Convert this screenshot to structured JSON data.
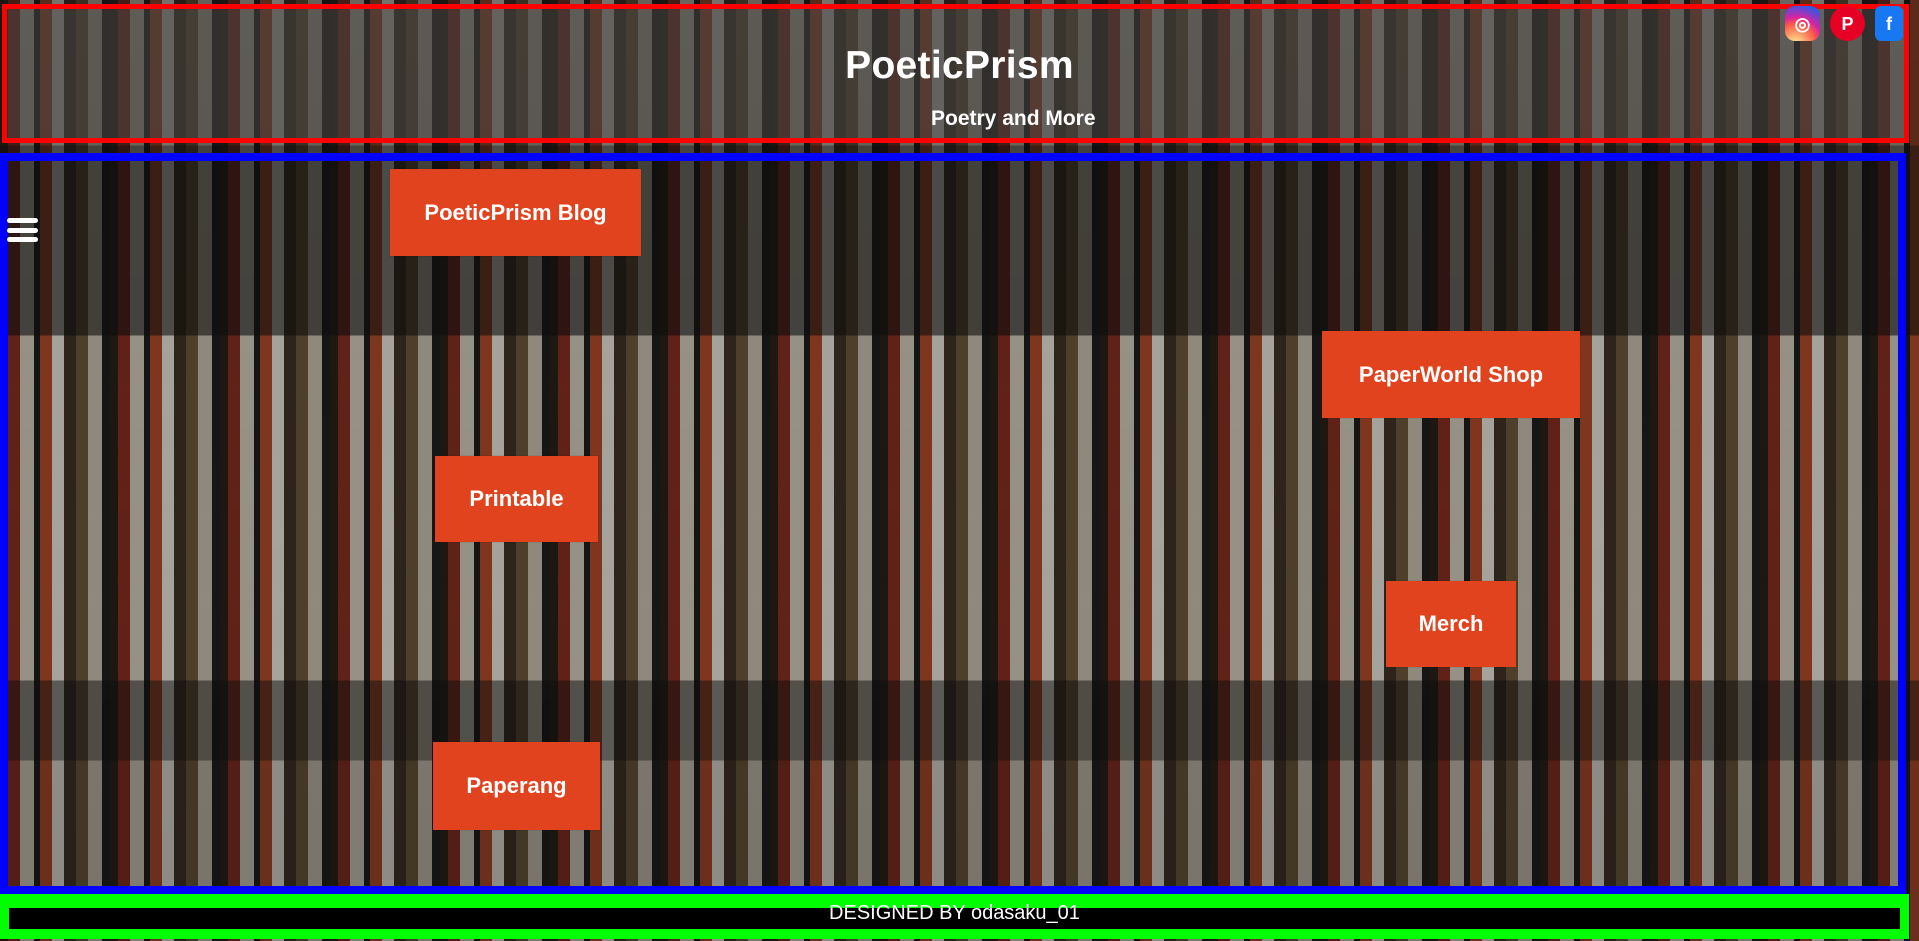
{
  "header": {
    "title": "PoeticPrism",
    "subtitle": "Poetry and More",
    "social": [
      {
        "name": "instagram-icon",
        "glyph": "◎"
      },
      {
        "name": "pinterest-icon",
        "glyph": "P"
      },
      {
        "name": "facebook-icon",
        "glyph": "f"
      }
    ]
  },
  "main": {
    "menu_icon": "menu-icon",
    "buttons": {
      "blog": "PoeticPrism Blog",
      "printable": "Printable",
      "paperang": "Paperang",
      "shop": "PaperWorld Shop",
      "merch": "Merch"
    }
  },
  "footer": {
    "text": "DESIGNED BY odasaku_01"
  }
}
